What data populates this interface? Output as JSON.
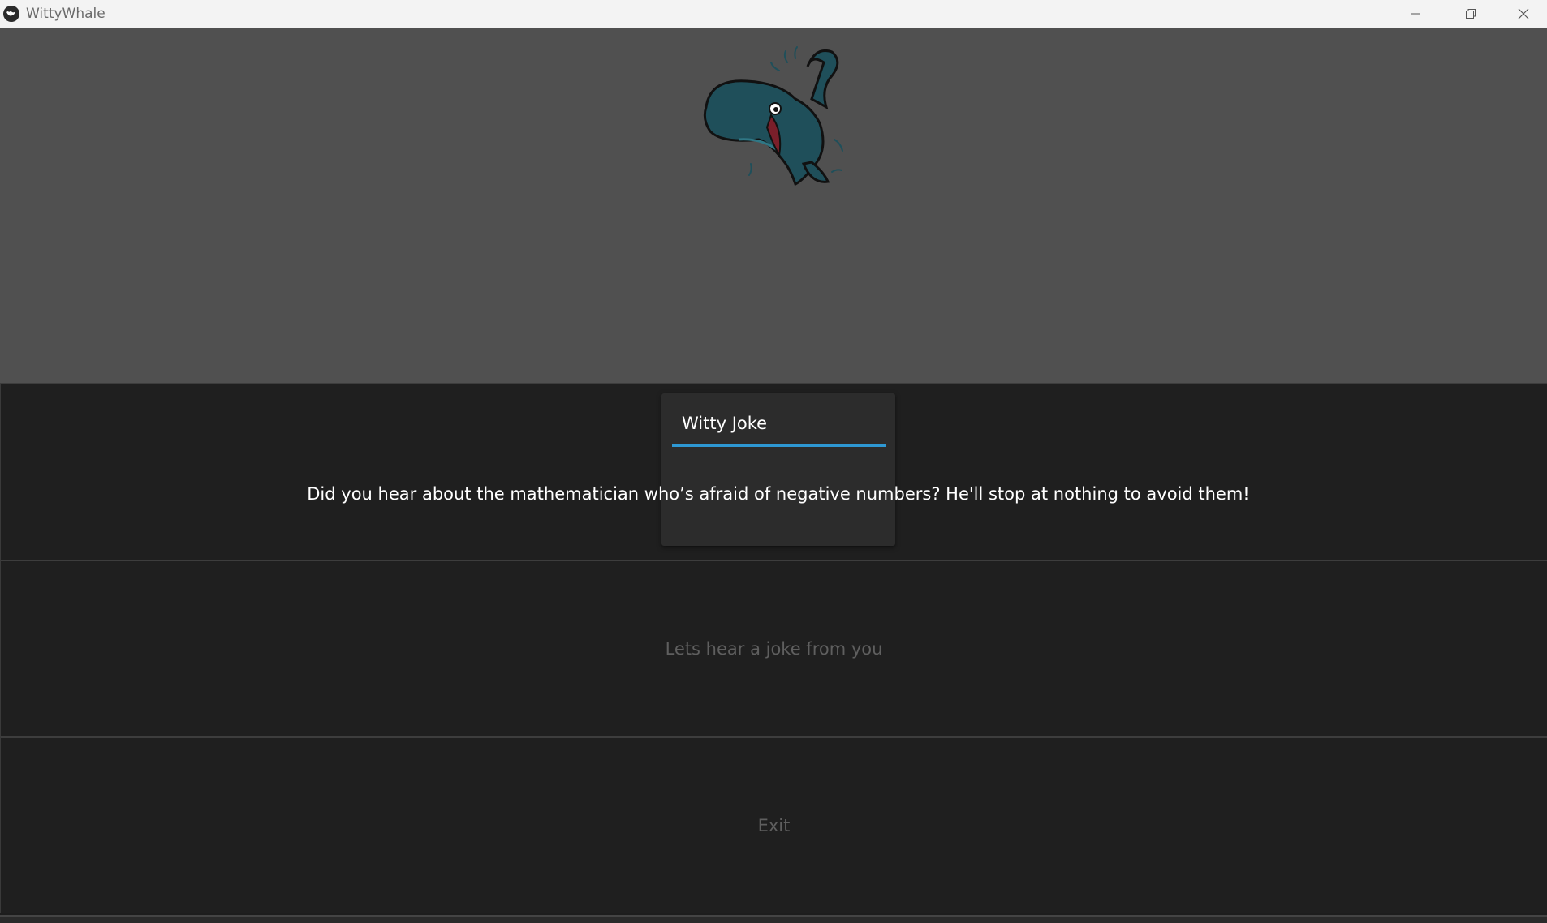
{
  "window": {
    "title": "WittyWhale",
    "controls": {
      "minimize_icon": "minimize-icon",
      "maximize_icon": "restore-icon",
      "close_icon": "close-icon"
    }
  },
  "dialog": {
    "title": "Witty Joke",
    "accent_color": "#2e98d3"
  },
  "joke": {
    "text": "Did you hear about the mathematician who’s afraid of negative numbers? He'll stop at nothing to avoid them!"
  },
  "buttons": {
    "joke_prompt_label": "Lets hear a joke from you",
    "exit_label": "Exit"
  },
  "colors": {
    "hero_bg": "#505050",
    "panel_bg": "#1f1f1f",
    "whale": "#1f4f5a"
  }
}
